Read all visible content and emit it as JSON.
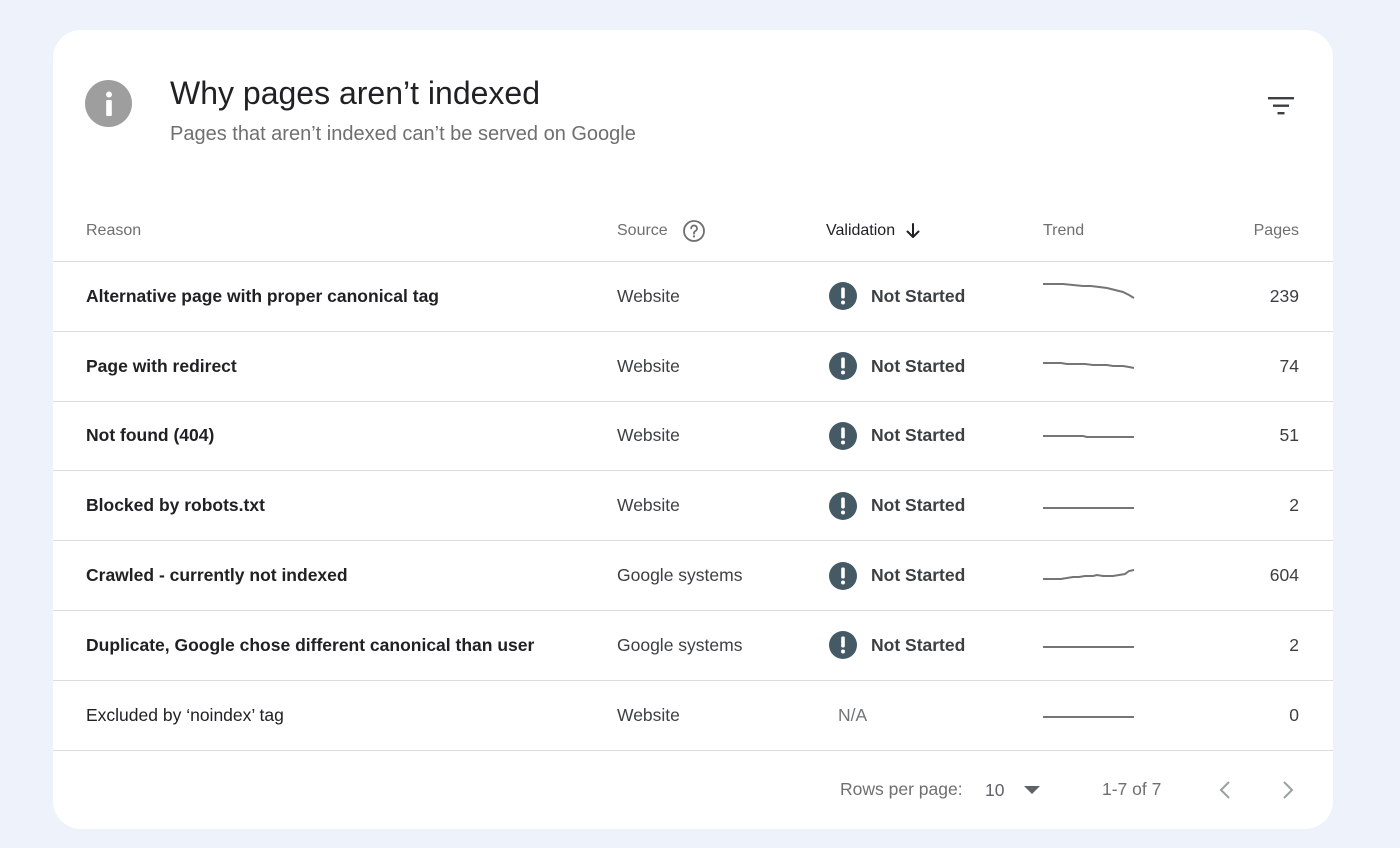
{
  "header": {
    "title": "Why pages aren’t indexed",
    "subtitle": "Pages that aren’t indexed can’t be served on Google"
  },
  "columns": {
    "reason": "Reason",
    "source": "Source",
    "validation": "Validation",
    "trend": "Trend",
    "pages": "Pages"
  },
  "rows": [
    {
      "reason": "Alternative page with proper canonical tag",
      "source": "Website",
      "validation": "Not Started",
      "pages": "239",
      "trend": "decreasing"
    },
    {
      "reason": "Page with redirect",
      "source": "Website",
      "validation": "Not Started",
      "pages": "74",
      "trend": "slightly decreasing"
    },
    {
      "reason": "Not found (404)",
      "source": "Website",
      "validation": "Not Started",
      "pages": "51",
      "trend": "flat with small step down"
    },
    {
      "reason": "Blocked by robots.txt",
      "source": "Website",
      "validation": "Not Started",
      "pages": "2",
      "trend": "flat"
    },
    {
      "reason": "Crawled - currently not indexed",
      "source": "Google systems",
      "validation": "Not Started",
      "pages": "604",
      "trend": "increasing"
    },
    {
      "reason": "Duplicate, Google chose different canonical than user",
      "source": "Google systems",
      "validation": "Not Started",
      "pages": "2",
      "trend": "flat"
    },
    {
      "reason": "Excluded by ‘noindex’ tag",
      "source": "Website",
      "validation": "N/A",
      "pages": "0",
      "trend": "flat"
    }
  ],
  "footer": {
    "rows_per_page_label": "Rows per page:",
    "rows_per_page_value": "10",
    "range": "1-7 of 7"
  },
  "colors": {
    "background": "#eef2fa",
    "card": "#ffffff",
    "status_badge": "#455a64",
    "info_icon": "#9e9e9e",
    "trend_line": "#757575"
  },
  "icons": {
    "header": "info-icon",
    "filter": "filter-icon",
    "source_help": "help-circle-icon",
    "sort": "arrow-down-icon",
    "status": "exclamation-icon",
    "rows_dropdown": "caret-down-icon",
    "prev": "chevron-left-icon",
    "next": "chevron-right-icon"
  }
}
